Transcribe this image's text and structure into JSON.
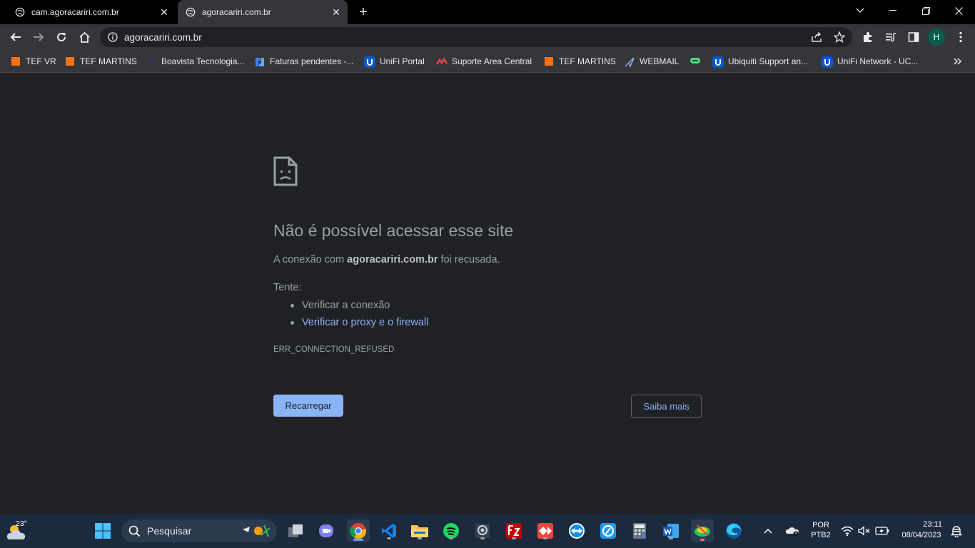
{
  "tabs": [
    {
      "title": "cam.agoracariri.com.br",
      "active": false
    },
    {
      "title": "agoracariri.com.br",
      "active": true
    }
  ],
  "omnibox": {
    "url": "agoracariri.com.br"
  },
  "profile": {
    "initial": "H"
  },
  "bookmarks": [
    "TEF VR",
    "TEF MARTINS",
    "Boavista Tecnologia...",
    "Faturas pendentes -...",
    "UniFi Portal",
    "Suporte Area Central",
    "TEF MARTINS",
    "WEBMAIL",
    "",
    "Ubiquiti Support an...",
    "UniFi Network - UC..."
  ],
  "error": {
    "title": "Não é possível acessar esse site",
    "desc_prefix": "A conexão com ",
    "desc_host": "agoracariri.com.br",
    "desc_suffix": " foi recusada.",
    "try_label": "Tente:",
    "suggestions": [
      "Verificar a conexão",
      "Verificar o proxy e o firewall"
    ],
    "code": "ERR_CONNECTION_REFUSED",
    "reload_label": "Recarregar",
    "more_label": "Saiba mais"
  },
  "taskbar": {
    "weather_temp": "23°",
    "search_label": "Pesquisar",
    "lang_line1": "POR",
    "lang_line2": "PTB2",
    "time": "23:11",
    "date": "08/04/2023"
  },
  "colors": {
    "accent": "#8ab4f8",
    "background": "#202124",
    "toolbar": "#35363a"
  }
}
